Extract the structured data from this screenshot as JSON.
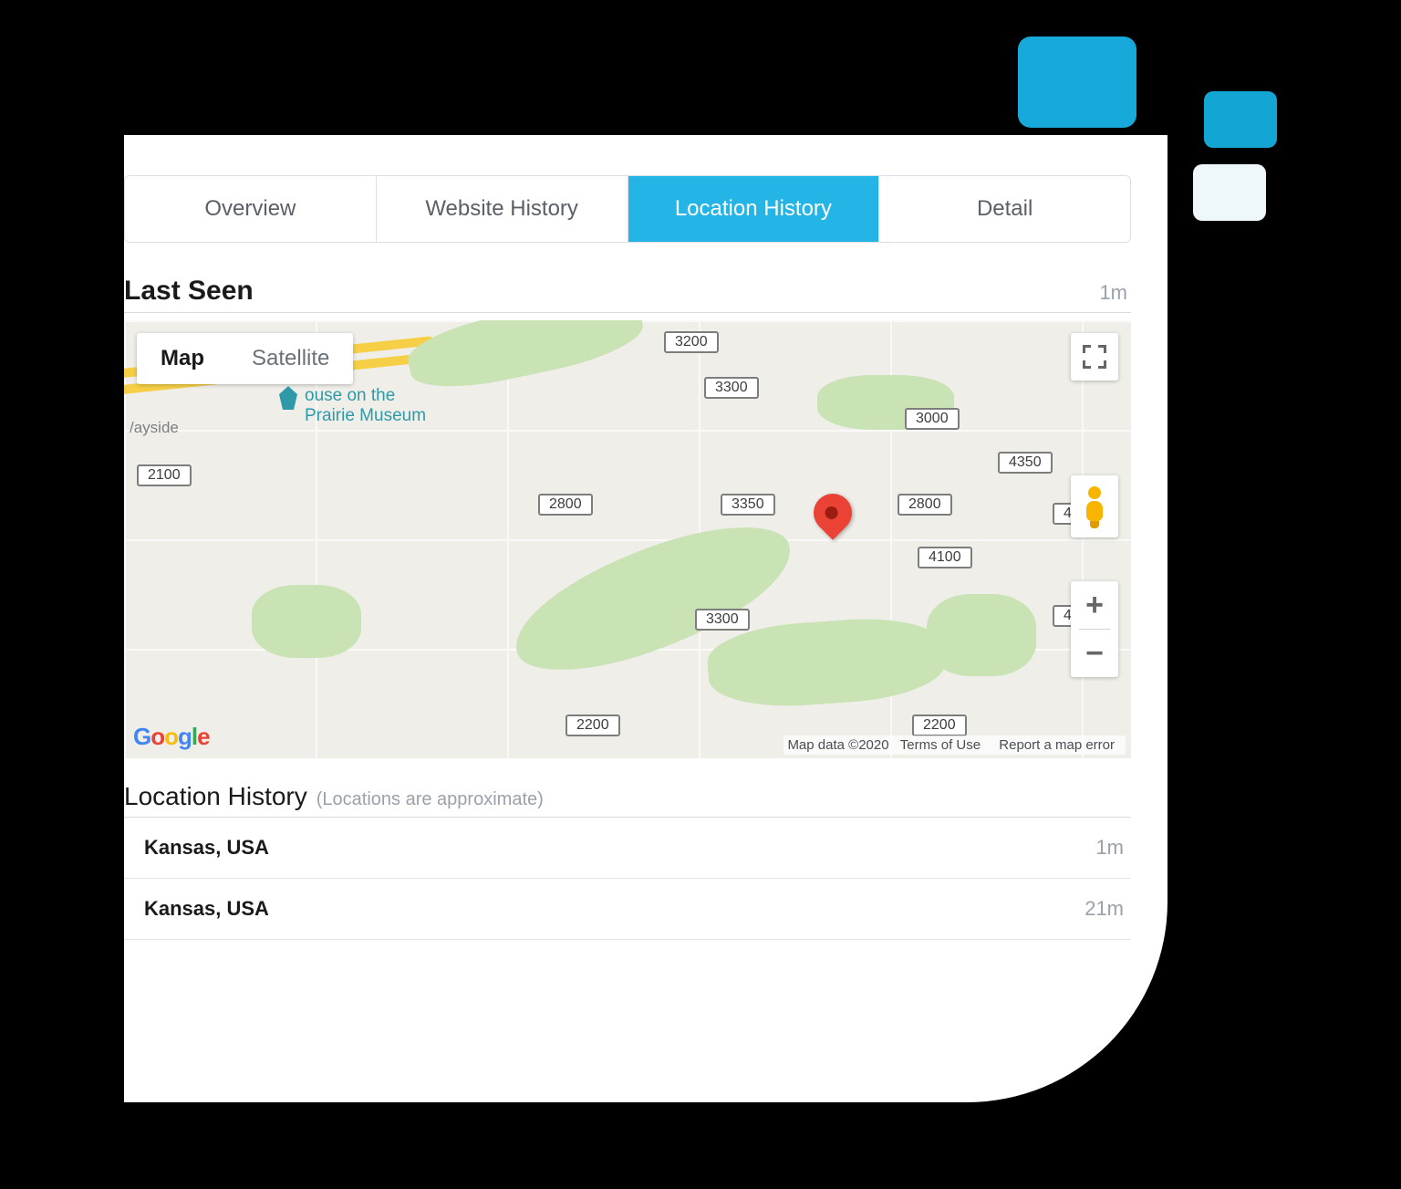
{
  "tabs": {
    "overview": "Overview",
    "website_history": "Website History",
    "location_history": "Location History",
    "detail": "Detail"
  },
  "last_seen": {
    "title": "Last Seen",
    "time": "1m"
  },
  "map": {
    "toggle_map": "Map",
    "toggle_satellite": "Satellite",
    "poi_name": "ouse on the\nPrairie Museum",
    "wayside_label": "/ayside",
    "shields": {
      "s3200": "3200",
      "s3300a": "3300",
      "s3000": "3000",
      "s2100": "2100",
      "s4350": "4350",
      "s2800a": "2800",
      "s3350": "3350",
      "s2800b": "2800",
      "s4xxx": "4",
      "s3300b": "3300",
      "s4100": "4100",
      "s4xxx2": "4",
      "s2200a": "2200",
      "s2200b": "2200"
    },
    "attribution": {
      "data": "Map data ©2020",
      "terms": "Terms of Use",
      "report": "Report a map error"
    },
    "zoom_in": "+",
    "zoom_out": "−"
  },
  "location_history": {
    "title": "Location History",
    "note": "(Locations are approximate)",
    "rows": [
      {
        "place": "Kansas, USA",
        "when": "1m"
      },
      {
        "place": "Kansas, USA",
        "when": "21m"
      }
    ]
  }
}
